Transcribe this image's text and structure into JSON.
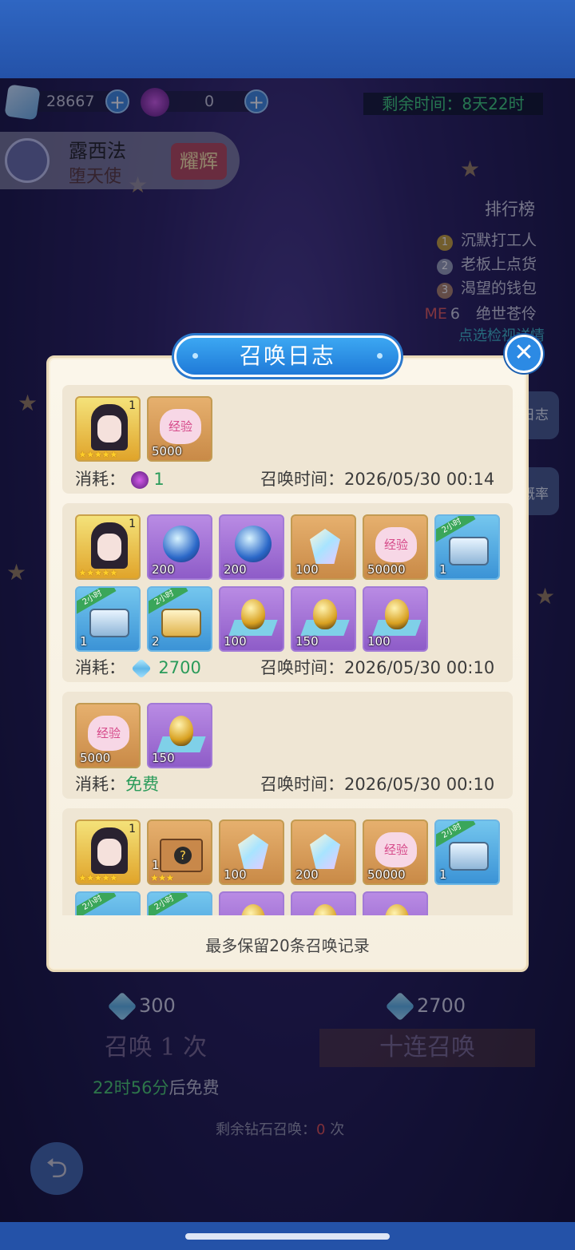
{
  "top": {
    "diamonds": "28667",
    "tickets": "0",
    "timer": "剩余时间：8天22时"
  },
  "character": {
    "name": "露西法",
    "title": "堕天使",
    "badge": "耀辉"
  },
  "ranking": {
    "title": "排行榜",
    "items": [
      "沉默打工人",
      "老板上点货",
      "渴望的钱包",
      "绝世苍伶"
    ],
    "rank_nums": [
      "1",
      "2",
      "3",
      "6"
    ],
    "me": "ME",
    "link": "点选检视详情"
  },
  "side_buttons": {
    "log": "日志",
    "rate": "概率"
  },
  "dialog": {
    "title": "召唤日志",
    "close": "✕",
    "footer": "最多保留20条召唤记录",
    "cost_label": "消耗：",
    "time_label": "召唤时间：",
    "entries": [
      {
        "cost": "1",
        "time": "2026/05/30 00:14",
        "items": [
          {
            "type": "character",
            "level": "1"
          },
          {
            "type": "exp",
            "qty": "5000"
          }
        ]
      },
      {
        "cost": "2700",
        "time": "2026/05/30 00:10",
        "items": [
          {
            "type": "character",
            "level": "1"
          },
          {
            "type": "orb",
            "qty": "200"
          },
          {
            "type": "orb",
            "qty": "200"
          },
          {
            "type": "crystal",
            "qty": "100"
          },
          {
            "type": "exp",
            "qty": "50000"
          },
          {
            "type": "chest",
            "qty": "1",
            "tag": "2小时"
          },
          {
            "type": "chest",
            "qty": "1",
            "tag": "2小时"
          },
          {
            "type": "chest-gold",
            "qty": "2",
            "tag": "2小时"
          },
          {
            "type": "egg",
            "qty": "100"
          },
          {
            "type": "egg",
            "qty": "150"
          },
          {
            "type": "egg",
            "qty": "100"
          }
        ]
      },
      {
        "cost": "免费",
        "time": "2026/05/30 00:10",
        "items": [
          {
            "type": "exp",
            "qty": "5000"
          },
          {
            "type": "egg",
            "qty": "150"
          }
        ]
      },
      {
        "items": [
          {
            "type": "character",
            "level": "1"
          },
          {
            "type": "mystery",
            "qty": "1"
          },
          {
            "type": "crystal",
            "qty": "100"
          },
          {
            "type": "crystal",
            "qty": "200"
          },
          {
            "type": "exp",
            "qty": "50000"
          },
          {
            "type": "chest",
            "qty": "1",
            "tag": "2小时"
          }
        ]
      }
    ]
  },
  "summon": {
    "single_cost": "300",
    "ten_cost": "2700",
    "single_label": "召唤 1 次",
    "ten_label": "十连召唤",
    "free_timer": "22时56分",
    "free_suffix": "后免费",
    "remaining_label": "剩余钻石召唤：",
    "remaining_count": "0",
    "remaining_unit": "次"
  },
  "labels": {
    "exp_text": "经验",
    "tag_2h": "2小时"
  }
}
